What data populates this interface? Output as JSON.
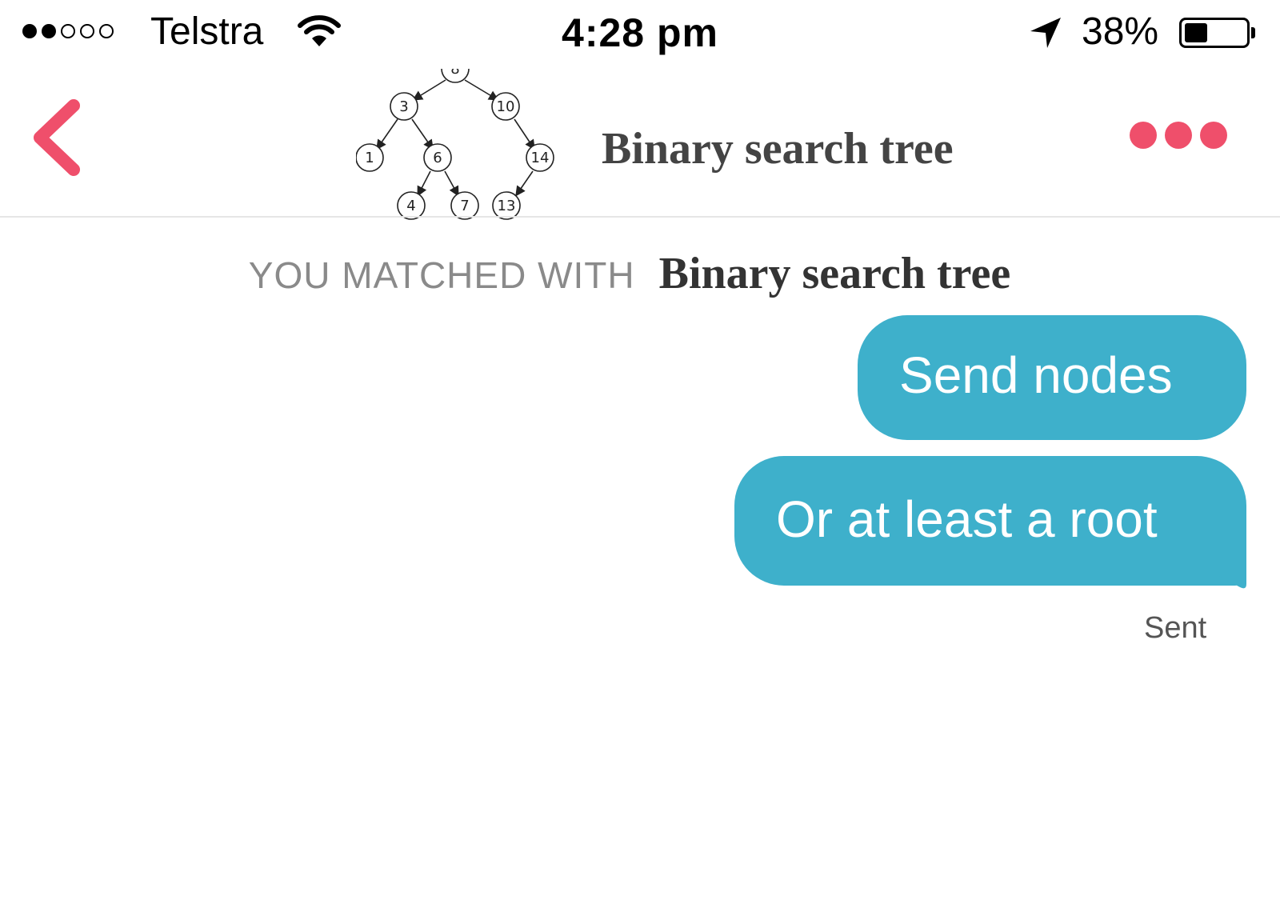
{
  "status_bar": {
    "carrier": "Telstra",
    "time": "4:28 pm",
    "battery_percent_label": "38%",
    "battery_level": 0.38,
    "signal_bars_filled": 2,
    "signal_bars_total": 5
  },
  "header": {
    "title": "Binary search tree",
    "back_icon": "chevron-left-icon",
    "more_icon": "ellipsis-icon",
    "accent_color": "#ef4f6b",
    "tree_nodes": [
      "8",
      "3",
      "10",
      "1",
      "6",
      "14",
      "4",
      "7",
      "13"
    ]
  },
  "matched": {
    "label": "YOU MATCHED WITH",
    "name": "Binary search tree"
  },
  "messages": [
    {
      "text": "Send nodes"
    },
    {
      "text": "Or at least a root"
    }
  ],
  "message_status": "Sent",
  "bubble_color": "#3eb0cb"
}
